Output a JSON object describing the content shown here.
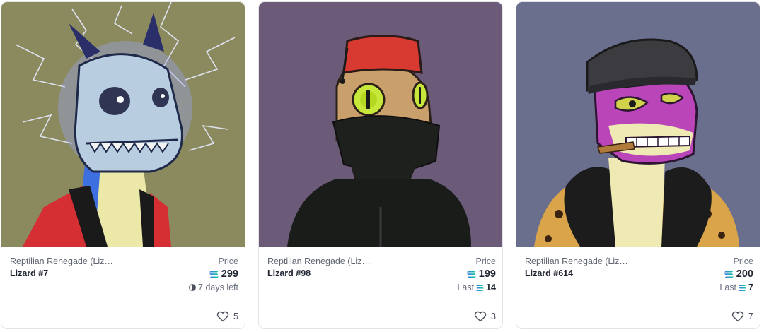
{
  "cards": [
    {
      "collection": "Reptilian Renegade (Lizard...)",
      "name": "Lizard #7",
      "price_label": "Price",
      "price": "299",
      "sub_text": "7 days left",
      "likes": "5",
      "background": "#8b8a5e",
      "icons": [
        "solana-icon",
        "clock-icon",
        "heart-icon"
      ]
    },
    {
      "collection": "Reptilian Renegade (Lizard...)",
      "name": "Lizard #98",
      "price_label": "Price",
      "price": "199",
      "last_label": "Last",
      "last_value": "14",
      "likes": "3",
      "background": "#6b5a78",
      "icons": [
        "solana-icon",
        "heart-icon"
      ]
    },
    {
      "collection": "Reptilian Renegade (Lizard...)",
      "name": "Lizard #614",
      "price_label": "Price",
      "price": "200",
      "last_label": "Last",
      "last_value": "7",
      "likes": "7",
      "background": "#6a6f8e",
      "icons": [
        "solana-icon",
        "heart-icon"
      ]
    }
  ]
}
